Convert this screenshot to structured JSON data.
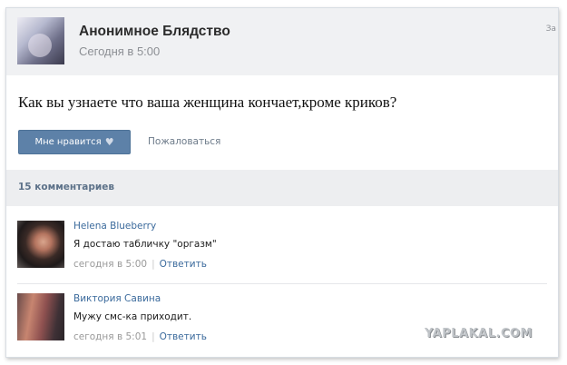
{
  "post": {
    "author": "Анонимное Блядство",
    "time": "Сегодня в 5:00",
    "corner": "За",
    "text": "Как вы узнаете что ваша женщина кончает,кроме криков?",
    "like_label": "Мне нравится",
    "report_label": "Пожаловаться"
  },
  "comments_header": "15 комментариев",
  "comments": [
    {
      "author": "Helena Blueberry",
      "text": "Я достаю табличку \"оргазм\"",
      "time": "сегодня в 5:00",
      "reply": "Ответить"
    },
    {
      "author": "Виктория Савина",
      "text": "Мужу смс-ка приходит.",
      "time": "сегодня в 5:01",
      "reply": "Ответить"
    }
  ],
  "watermark": "YAPLAKAL.COM",
  "icons": {
    "like": "heart-icon"
  },
  "colors": {
    "like_button": "#5d81a8",
    "link": "#3b6a9c"
  }
}
